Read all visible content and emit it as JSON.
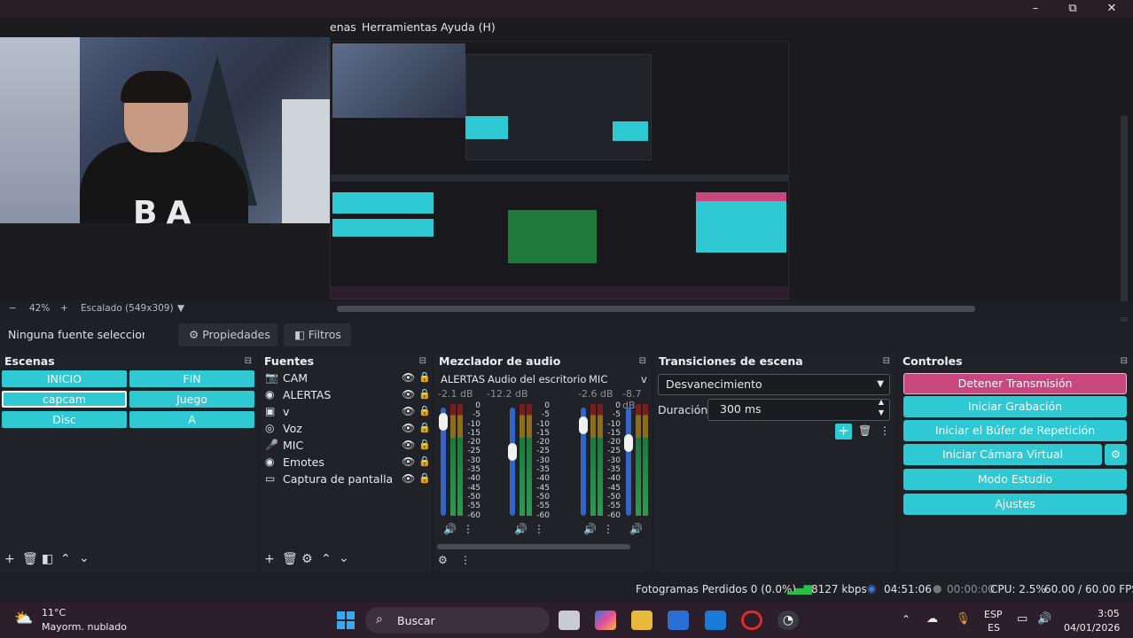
{
  "menu": {
    "item_scenes_partial": "enas",
    "item_tools": "Herramientas",
    "item_help": "Ayuda (H)"
  },
  "window_controls": {
    "minimize": "–",
    "maximize": "⧉",
    "close": "✕"
  },
  "preview": {
    "zoom": "42%",
    "scaling": "Escalado (549x309)"
  },
  "source_toolbar": {
    "no_source": "Ninguna fuente seleccionada",
    "properties": "Propiedades",
    "filters": "Filtros"
  },
  "scenes": {
    "title": "Escenas",
    "items": [
      {
        "label": "INICIO"
      },
      {
        "label": "FIN"
      },
      {
        "label": "capcam"
      },
      {
        "label": "Juego"
      },
      {
        "label": "Disc"
      },
      {
        "label": "A"
      }
    ]
  },
  "sources": {
    "title": "Fuentes",
    "items": [
      {
        "label": "CAM",
        "icon": "camera-icon"
      },
      {
        "label": "ALERTAS",
        "icon": "globe-icon"
      },
      {
        "label": "v",
        "icon": "media-icon"
      },
      {
        "label": "Voz",
        "icon": "headset-icon"
      },
      {
        "label": "MIC",
        "icon": "microphone-icon"
      },
      {
        "label": "Emotes",
        "icon": "globe-icon"
      },
      {
        "label": "Captura de pantalla",
        "icon": "monitor-icon"
      }
    ]
  },
  "mixer": {
    "title": "Mezclador de audio",
    "channels": [
      {
        "name": "ALERTAS",
        "db": "-2.1 dB"
      },
      {
        "name": "Audio del escritorio",
        "db": "-12.2 dB"
      },
      {
        "name": "MIC",
        "db": "-2.6 dB"
      },
      {
        "name": "v",
        "db": "-8.7 dB"
      }
    ],
    "scale": [
      "0",
      "-5",
      "-10",
      "-15",
      "-20",
      "-25",
      "-30",
      "-35",
      "-40",
      "-45",
      "-50",
      "-55",
      "-60"
    ]
  },
  "transitions": {
    "title": "Transiciones de escena",
    "selected": "Desvanecimiento",
    "duration_label": "Duración",
    "duration_value": "300 ms"
  },
  "controls": {
    "title": "Controles",
    "stop_stream": "Detener Transmisión",
    "start_recording": "Iniciar Grabación",
    "start_replay": "Iniciar el Búfer de Repetición",
    "start_virtualcam": "Iniciar Cámara Virtual",
    "studio_mode": "Modo Estudio",
    "settings": "Ajustes"
  },
  "status": {
    "dropped_frames": "Fotogramas Perdidos 0 (0.0%)",
    "bitrate": "8127 kbps",
    "stream_time": "04:51:06",
    "rec_time": "00:00:00",
    "cpu": "CPU: 2.5%",
    "fps": "60.00 / 60.00 FPS"
  },
  "taskbar": {
    "weather_temp": "11°C",
    "weather_desc": "Mayorm. nublado",
    "search": "Buscar",
    "lang_top": "ESP",
    "lang_bottom": "ES",
    "time": "3:05",
    "date": "04/01/2026"
  }
}
